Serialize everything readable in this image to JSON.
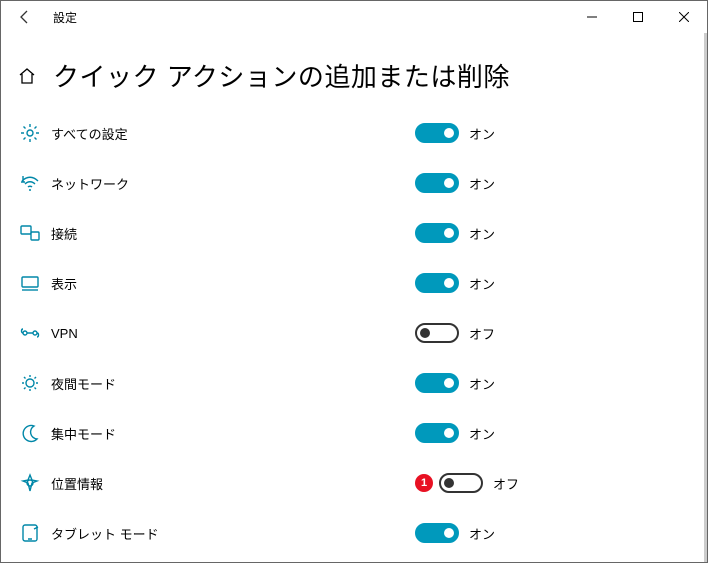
{
  "window": {
    "title": "設定"
  },
  "page": {
    "title": "クイック アクションの追加または削除"
  },
  "toggle_labels": {
    "on": "オン",
    "off": "オフ"
  },
  "items": [
    {
      "id": "all-settings",
      "label": "すべての設定",
      "on": true,
      "icon": "gear"
    },
    {
      "id": "network",
      "label": "ネットワーク",
      "on": true,
      "icon": "wifi"
    },
    {
      "id": "connect",
      "label": "接続",
      "on": true,
      "icon": "connect"
    },
    {
      "id": "project",
      "label": "表示",
      "on": true,
      "icon": "project"
    },
    {
      "id": "vpn",
      "label": "VPN",
      "on": false,
      "icon": "vpn"
    },
    {
      "id": "night-light",
      "label": "夜間モード",
      "on": true,
      "icon": "night"
    },
    {
      "id": "focus-assist",
      "label": "集中モード",
      "on": true,
      "icon": "moon"
    },
    {
      "id": "location",
      "label": "位置情報",
      "on": false,
      "icon": "location",
      "badge": "1"
    },
    {
      "id": "tablet-mode",
      "label": "タブレット モード",
      "on": true,
      "icon": "tablet"
    }
  ],
  "colors": {
    "accent": "#0099bc",
    "icon": "#0087a8",
    "badge": "#e81123"
  }
}
